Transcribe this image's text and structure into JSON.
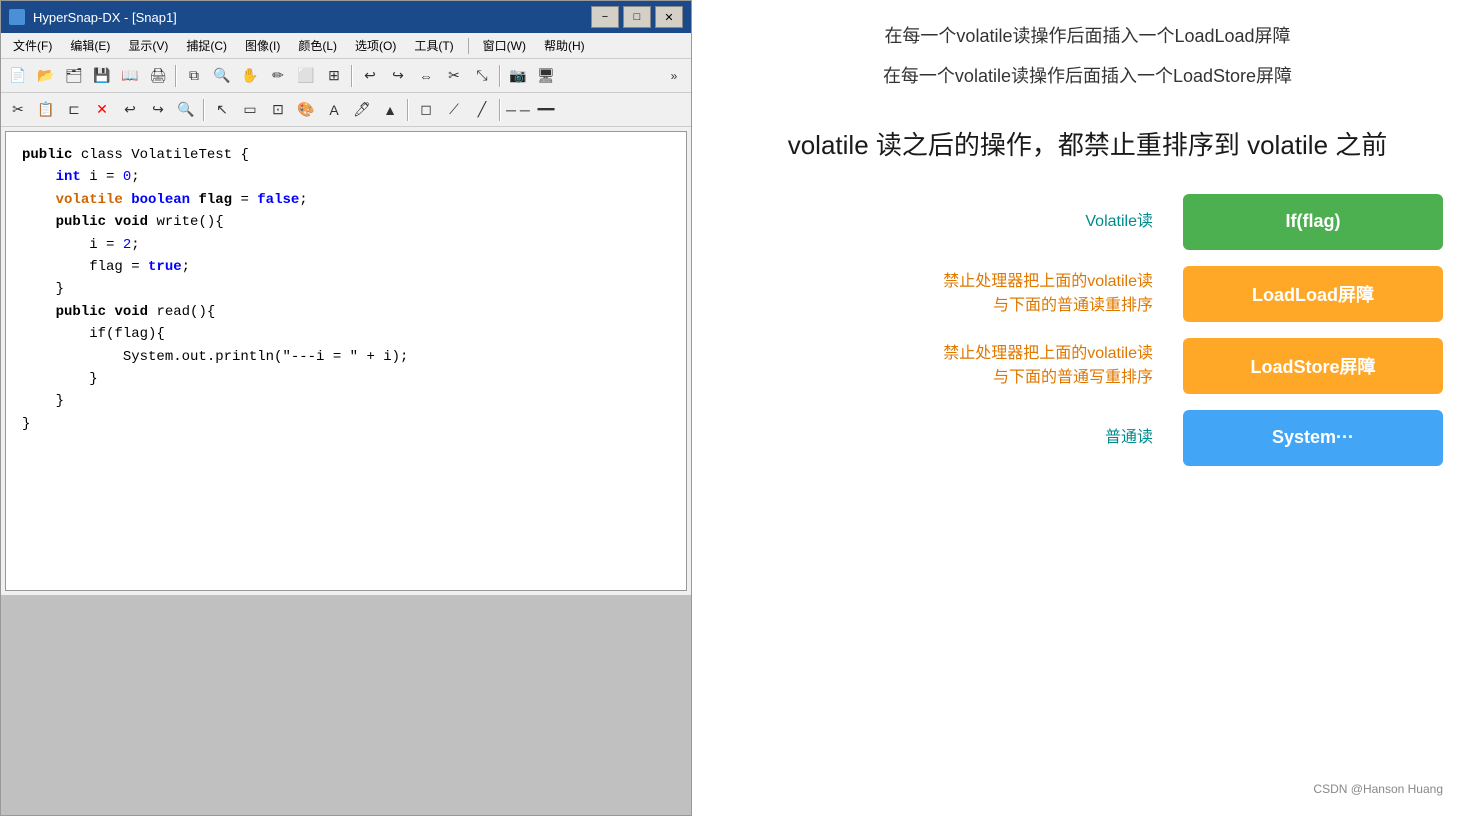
{
  "window": {
    "title": "HyperSnap-DX - [Snap1]",
    "icon": "camera-icon"
  },
  "titlebar": {
    "title": "HyperSnap-DX - [Snap1]",
    "minimize": "−",
    "restore": "□",
    "close": "✕"
  },
  "menubar": {
    "items": [
      {
        "label": "文件(F)"
      },
      {
        "label": "编辑(E)"
      },
      {
        "label": "显示(V)"
      },
      {
        "label": "捕捉(C)"
      },
      {
        "label": "图像(I)"
      },
      {
        "label": "颜色(L)"
      },
      {
        "label": "选项(O)"
      },
      {
        "label": "工具(T)"
      },
      {
        "label": "窗口(W)"
      },
      {
        "label": "帮助(H)"
      }
    ]
  },
  "code": {
    "lines": [
      {
        "text": "public class VolatileTest {",
        "parts": [
          {
            "text": "public",
            "style": "kw-black"
          },
          {
            "text": " class ",
            "style": "kw-default"
          },
          {
            "text": "VolatileTest",
            "style": "kw-default"
          },
          {
            "text": " {",
            "style": "kw-default"
          }
        ]
      },
      {
        "text": "    int i = 0;",
        "parts": [
          {
            "text": "    ",
            "style": "kw-default"
          },
          {
            "text": "int",
            "style": "kw-blue"
          },
          {
            "text": " i = ",
            "style": "kw-default"
          },
          {
            "text": "0",
            "style": "kw-number"
          },
          {
            "text": ";",
            "style": "kw-default"
          }
        ]
      },
      {
        "text": "    volatile boolean flag = false;",
        "parts": [
          {
            "text": "    ",
            "style": "kw-default"
          },
          {
            "text": "volatile",
            "style": "kw-orange"
          },
          {
            "text": " ",
            "style": "kw-default"
          },
          {
            "text": "boolean",
            "style": "kw-blue"
          },
          {
            "text": " flag = ",
            "style": "kw-default"
          },
          {
            "text": "false",
            "style": "kw-blue"
          },
          {
            "text": ";",
            "style": "kw-default"
          }
        ]
      },
      {
        "text": "    public void write(){",
        "parts": [
          {
            "text": "    ",
            "style": "kw-default"
          },
          {
            "text": "public",
            "style": "kw-black"
          },
          {
            "text": " ",
            "style": "kw-default"
          },
          {
            "text": "void",
            "style": "kw-black"
          },
          {
            "text": " write(){",
            "style": "kw-default"
          }
        ]
      },
      {
        "text": "        i = 2;",
        "parts": [
          {
            "text": "        i = ",
            "style": "kw-default"
          },
          {
            "text": "2",
            "style": "kw-number"
          },
          {
            "text": ";",
            "style": "kw-default"
          }
        ]
      },
      {
        "text": "        flag = true;",
        "parts": [
          {
            "text": "        flag = ",
            "style": "kw-default"
          },
          {
            "text": "true",
            "style": "kw-blue"
          },
          {
            "text": ";",
            "style": "kw-default"
          }
        ]
      },
      {
        "text": "    }",
        "parts": [
          {
            "text": "    }",
            "style": "kw-default"
          }
        ]
      },
      {
        "text": "    public void read(){",
        "parts": [
          {
            "text": "    ",
            "style": "kw-default"
          },
          {
            "text": "public",
            "style": "kw-black"
          },
          {
            "text": " ",
            "style": "kw-default"
          },
          {
            "text": "void",
            "style": "kw-black"
          },
          {
            "text": " read(){",
            "style": "kw-default"
          }
        ]
      },
      {
        "text": "        if(flag){",
        "parts": [
          {
            "text": "        if(flag){",
            "style": "kw-default"
          }
        ]
      },
      {
        "text": "            System.out.println(\"---i = \" + i);",
        "parts": [
          {
            "text": "            System.out.println(\"---i = \" + i);",
            "style": "kw-default"
          }
        ]
      },
      {
        "text": "        }",
        "parts": [
          {
            "text": "        }",
            "style": "kw-default"
          }
        ]
      },
      {
        "text": "    }",
        "parts": [
          {
            "text": "    }",
            "style": "kw-default"
          }
        ]
      },
      {
        "text": "}",
        "parts": [
          {
            "text": "}",
            "style": "kw-default"
          }
        ]
      }
    ]
  },
  "right": {
    "info_line1": "在每一个volatile读操作后面插入一个LoadLoad屏障",
    "info_line2": "在每一个volatile读操作后面插入一个LoadStore屏障",
    "big_text": "volatile 读之后的操作，都禁止重排序到 volatile 之前",
    "rows": [
      {
        "label": "Volatile读",
        "label_style": "teal",
        "box_text": "If(flag)",
        "box_style": "box-green"
      },
      {
        "label": "禁止处理器把上面的volatile读\n与下面的普通读重排序",
        "label_style": "orange",
        "box_text": "LoadLoad屏障",
        "box_style": "box-orange"
      },
      {
        "label": "禁止处理器把上面的volatile读\n与下面的普通写重排序",
        "label_style": "orange",
        "box_text": "LoadStore屏障",
        "box_style": "box-orange"
      },
      {
        "label": "普通读",
        "label_style": "teal",
        "box_text": "System···",
        "box_style": "box-blue"
      }
    ],
    "watermark": "CSDN @Hanson Huang"
  }
}
